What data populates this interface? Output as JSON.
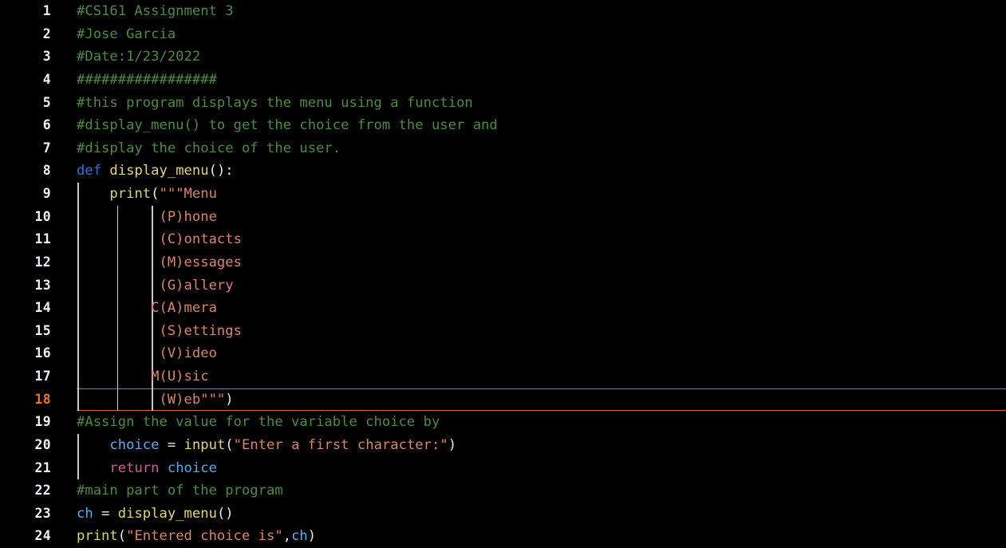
{
  "editor": {
    "language": "Python",
    "background_color": "#000000",
    "gutter_color": "#eef2f5",
    "current_line": 18,
    "current_line_border_color": "#d96a13",
    "current_line_number_color": "#e8761c",
    "total_lines": 24,
    "colors": {
      "comment": "#4e8b42",
      "keyword_def": "#2f6fdf",
      "keyword_return": "#d45b9a",
      "function": "#e5d57a",
      "builtin": "#d5d86b",
      "identifier": "#4fb0f2",
      "string": "#d98568",
      "punctuation": "#eaeaea",
      "indent_guide": "#c9c9c9"
    }
  },
  "lines": [
    {
      "num": "1",
      "indent_guides": 0,
      "tokens": [
        {
          "t": "#CS161 Assignment 3",
          "c": "cmt"
        }
      ]
    },
    {
      "num": "2",
      "indent_guides": 0,
      "tokens": [
        {
          "t": "#Jose Garcia",
          "c": "cmt"
        }
      ]
    },
    {
      "num": "3",
      "indent_guides": 0,
      "tokens": [
        {
          "t": "#Date:1/23/2022",
          "c": "cmt"
        }
      ]
    },
    {
      "num": "4",
      "indent_guides": 0,
      "tokens": [
        {
          "t": "#################",
          "c": "cmt"
        }
      ]
    },
    {
      "num": "5",
      "indent_guides": 0,
      "tokens": [
        {
          "t": "#this program displays the menu using a function",
          "c": "cmt"
        }
      ]
    },
    {
      "num": "6",
      "indent_guides": 0,
      "tokens": [
        {
          "t": "#display_menu() to get the choice from the user and",
          "c": "cmt"
        }
      ]
    },
    {
      "num": "7",
      "indent_guides": 0,
      "tokens": [
        {
          "t": "#display the choice of the user.",
          "c": "cmt"
        }
      ]
    },
    {
      "num": "8",
      "indent_guides": 0,
      "tokens": [
        {
          "t": "def",
          "c": "kw"
        },
        {
          "t": " ",
          "c": "pun"
        },
        {
          "t": "display_menu",
          "c": "fn"
        },
        {
          "t": "():",
          "c": "pun"
        }
      ]
    },
    {
      "num": "9",
      "indent_guides": 1,
      "tokens": [
        {
          "t": "    ",
          "c": "pun"
        },
        {
          "t": "print",
          "c": "bi"
        },
        {
          "t": "(",
          "c": "pun"
        },
        {
          "t": "\"\"\"Menu",
          "c": "str"
        }
      ]
    },
    {
      "num": "10",
      "indent_guides": 3,
      "tokens": [
        {
          "t": "          (P)hone",
          "c": "str"
        }
      ]
    },
    {
      "num": "11",
      "indent_guides": 3,
      "tokens": [
        {
          "t": "          (C)ontacts",
          "c": "str"
        }
      ]
    },
    {
      "num": "12",
      "indent_guides": 3,
      "tokens": [
        {
          "t": "          (M)essages",
          "c": "str"
        }
      ]
    },
    {
      "num": "13",
      "indent_guides": 3,
      "tokens": [
        {
          "t": "          (G)allery",
          "c": "str"
        }
      ]
    },
    {
      "num": "14",
      "indent_guides": 3,
      "tokens": [
        {
          "t": "         C(A)mera",
          "c": "str"
        }
      ]
    },
    {
      "num": "15",
      "indent_guides": 3,
      "tokens": [
        {
          "t": "          (S)ettings",
          "c": "str"
        }
      ]
    },
    {
      "num": "16",
      "indent_guides": 3,
      "tokens": [
        {
          "t": "          (V)ideo",
          "c": "str"
        }
      ]
    },
    {
      "num": "17",
      "indent_guides": 3,
      "tokens": [
        {
          "t": "         M(U)sic",
          "c": "str"
        }
      ]
    },
    {
      "num": "18",
      "indent_guides": 3,
      "current": true,
      "tokens": [
        {
          "t": "          (W)eb\"\"\"",
          "c": "str"
        },
        {
          "t": ")",
          "c": "pun"
        }
      ]
    },
    {
      "num": "19",
      "indent_guides": 0,
      "tokens": [
        {
          "t": "#Assign the value for the variable choice by",
          "c": "cmt"
        }
      ]
    },
    {
      "num": "20",
      "indent_guides": 1,
      "tokens": [
        {
          "t": "    ",
          "c": "pun"
        },
        {
          "t": "choice",
          "c": "var"
        },
        {
          "t": " = ",
          "c": "op"
        },
        {
          "t": "input",
          "c": "fn"
        },
        {
          "t": "(",
          "c": "pun"
        },
        {
          "t": "\"Enter a first character:\"",
          "c": "str"
        },
        {
          "t": ")",
          "c": "pun"
        }
      ]
    },
    {
      "num": "21",
      "indent_guides": 1,
      "tokens": [
        {
          "t": "    ",
          "c": "pun"
        },
        {
          "t": "return",
          "c": "kw2"
        },
        {
          "t": " ",
          "c": "pun"
        },
        {
          "t": "choice",
          "c": "var"
        }
      ]
    },
    {
      "num": "22",
      "indent_guides": 0,
      "tokens": [
        {
          "t": "#main part of the program",
          "c": "cmt"
        }
      ]
    },
    {
      "num": "23",
      "indent_guides": 0,
      "tokens": [
        {
          "t": "ch",
          "c": "var"
        },
        {
          "t": " = ",
          "c": "op"
        },
        {
          "t": "display_menu",
          "c": "fn"
        },
        {
          "t": "()",
          "c": "pun"
        }
      ]
    },
    {
      "num": "24",
      "indent_guides": 0,
      "tokens": [
        {
          "t": "print",
          "c": "bi"
        },
        {
          "t": "(",
          "c": "pun"
        },
        {
          "t": "\"Entered choice is\"",
          "c": "str"
        },
        {
          "t": ",",
          "c": "pun"
        },
        {
          "t": "ch",
          "c": "var"
        },
        {
          "t": ")",
          "c": "pun"
        }
      ]
    }
  ],
  "source_text": "#CS161 Assignment 3\n#Jose Garcia\n#Date:1/23/2022\n#################\n#this program displays the menu using a function\n#display_menu() to get the choice from the user and\n#display the choice of the user.\ndef display_menu():\n    print(\"\"\"Menu\n          (P)hone\n          (C)ontacts\n          (M)essages\n          (G)allery\n         C(A)mera\n          (S)ettings\n          (V)ideo\n         M(U)sic\n          (W)eb\"\"\")\n#Assign the value for the variable choice by\n    choice = input(\"Enter a first character:\")\n    return choice\n#main part of the program\nch = display_menu()\nprint(\"Entered choice is\",ch)"
}
